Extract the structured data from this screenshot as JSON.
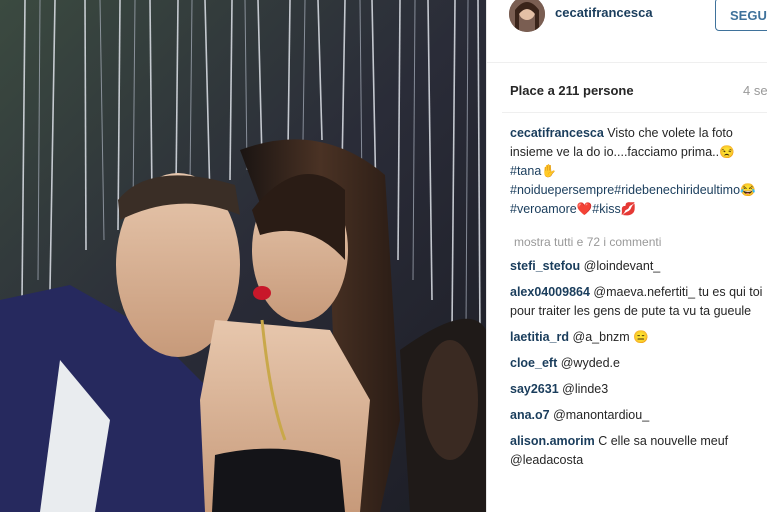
{
  "post": {
    "username": "cecatifrancesca",
    "follow_label": "SEGUI",
    "likes_text": "Place a 211 persone",
    "time_text": "4 se",
    "caption_parts": [
      {
        "type": "text",
        "text": " Visto che volete la foto insieme ve la do io....facciamo prima..😒"
      },
      {
        "type": "tag",
        "text": "#tana"
      },
      {
        "type": "text",
        "text": "✋"
      },
      {
        "type": "tag",
        "text": "#noiduepersempre"
      },
      {
        "type": "tag",
        "text": "#ridebenechirideultimo"
      },
      {
        "type": "text",
        "text": "😂"
      },
      {
        "type": "tag",
        "text": "#veroamore"
      },
      {
        "type": "text",
        "text": "❤️"
      },
      {
        "type": "tag",
        "text": "#kiss"
      },
      {
        "type": "text",
        "text": "💋"
      }
    ],
    "view_all_comments": "mostra tutti e 72 i commenti"
  },
  "comments": [
    {
      "user": "stefi_stefou",
      "text": " @loindevant_"
    },
    {
      "user": "alex04009864",
      "text": " @maeva.nefertiti_ tu es qui toi pour traiter les gens de pute ta vu ta gueule"
    },
    {
      "user": "laetitia_rd",
      "text": " @a_bnzm 😑"
    },
    {
      "user": "cloe_eft",
      "text": " @wyded.e"
    },
    {
      "user": "say2631",
      "text": " @linde3"
    },
    {
      "user": "ana.o7",
      "text": " @manontardiou_"
    },
    {
      "user": "alison.amorim",
      "text": " C elle sa nouvelle meuf @leadacosta"
    }
  ],
  "colors": {
    "username": "#1a3d5c",
    "follow_border": "#3f729b",
    "meta_gray": "#999999"
  },
  "icons": {
    "avatar": "profile-avatar"
  }
}
